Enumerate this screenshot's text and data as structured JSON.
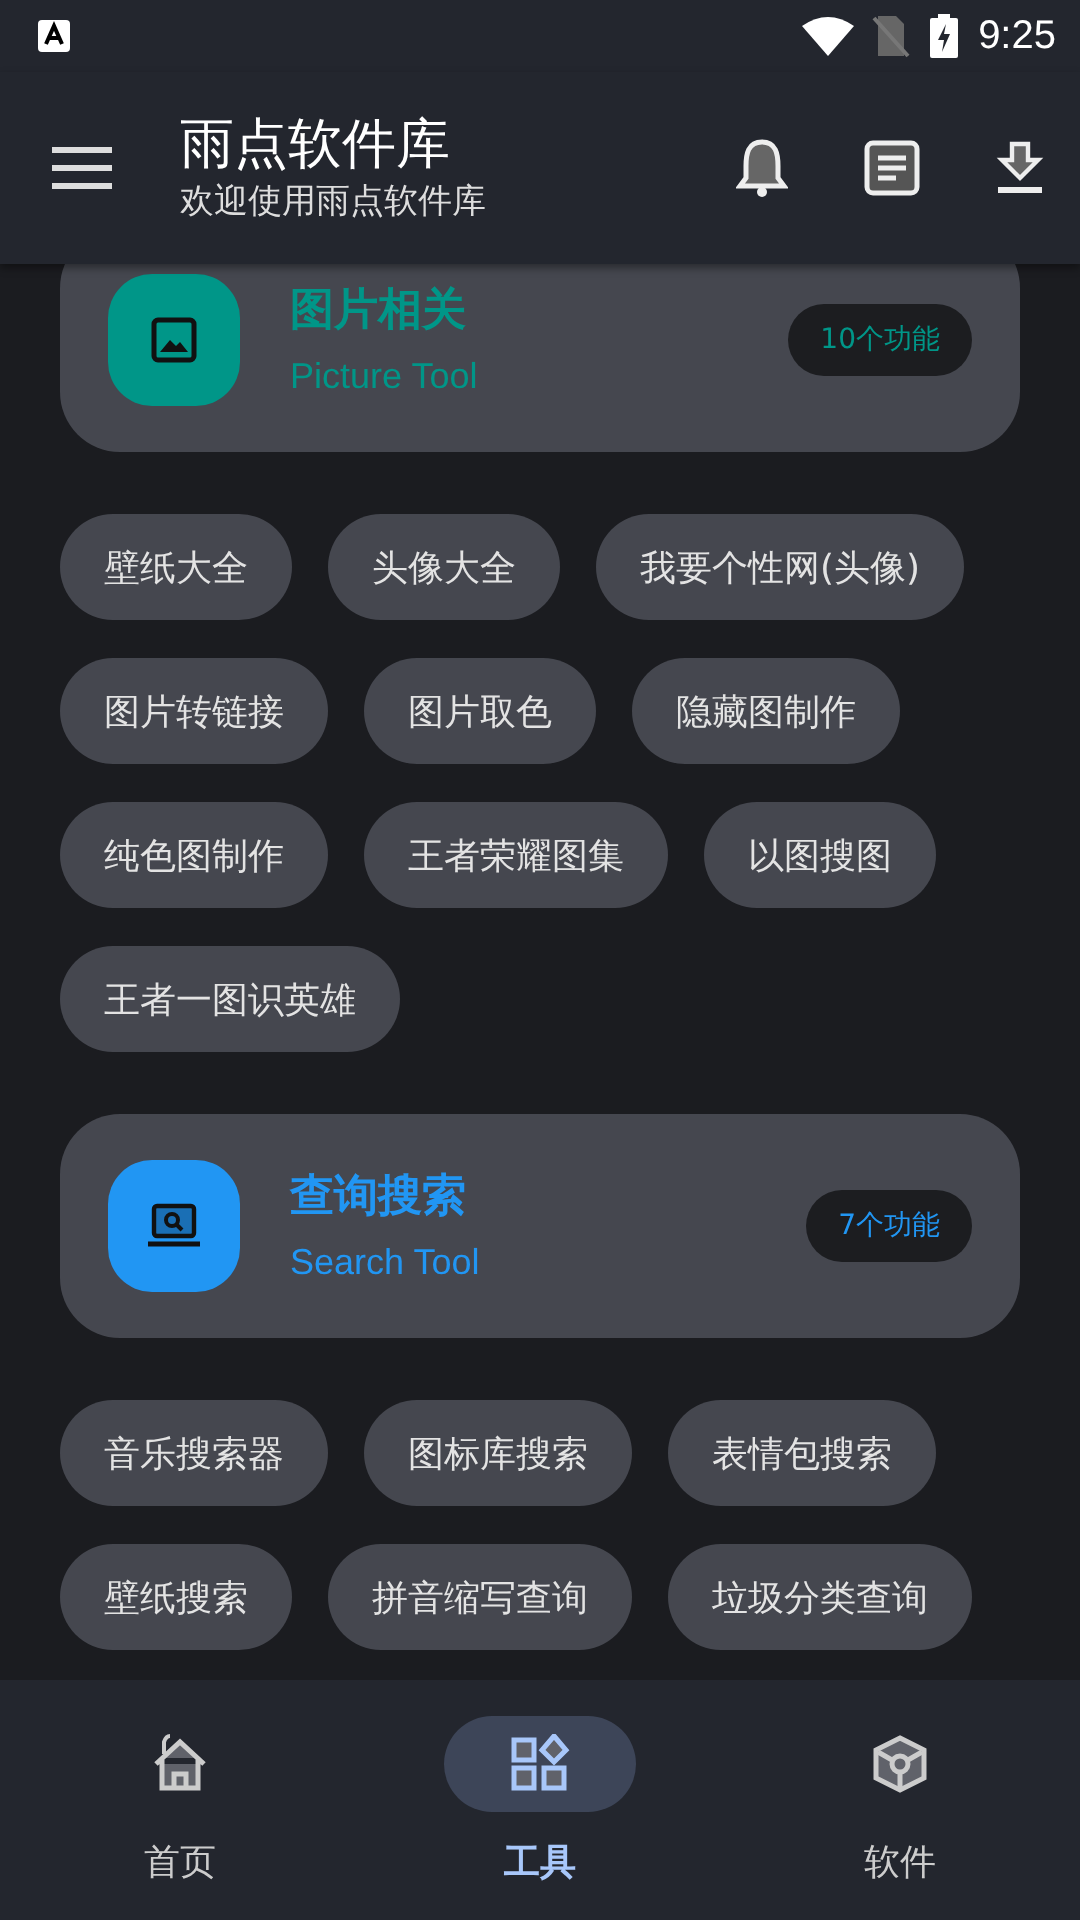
{
  "status_bar": {
    "time": "9:25"
  },
  "app_bar": {
    "title": "雨点软件库",
    "subtitle": "欢迎使用雨点软件库"
  },
  "sections": [
    {
      "title": "图片相关",
      "subtitle": "Picture Tool",
      "count": "10个功能",
      "color": "#009688",
      "kind": "picture",
      "tools": [
        "壁纸大全",
        "头像大全",
        "我要个性网(头像)",
        "图片转链接",
        "图片取色",
        "隐藏图制作",
        "纯色图制作",
        "王者荣耀图集",
        "以图搜图",
        "王者一图识英雄"
      ]
    },
    {
      "title": "查询搜索",
      "subtitle": "Search Tool",
      "count": "7个功能",
      "color": "#2196f3",
      "kind": "search",
      "tools": [
        "音乐搜索器",
        "图标库搜索",
        "表情包搜索",
        "壁纸搜索",
        "拼音缩写查询",
        "垃圾分类查询"
      ]
    }
  ],
  "nav": [
    {
      "label": "首页",
      "kind": "home",
      "selected": false
    },
    {
      "label": "工具",
      "kind": "tools",
      "selected": true
    },
    {
      "label": "软件",
      "kind": "software",
      "selected": false
    }
  ]
}
